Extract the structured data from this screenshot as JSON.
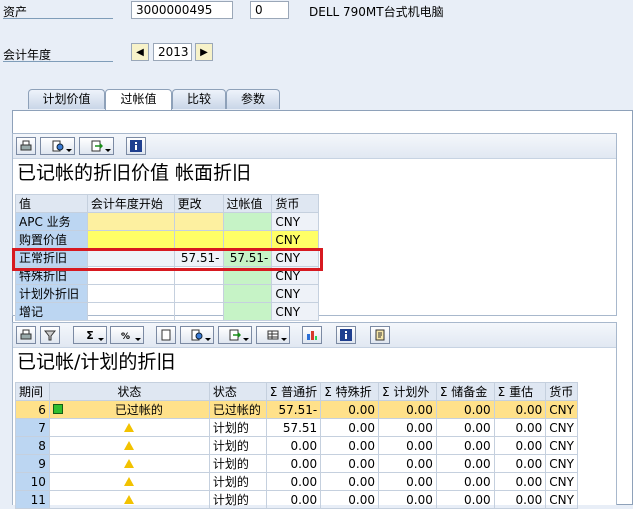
{
  "header": {
    "asset_label": "资产",
    "asset_number": "3000000495",
    "sub_number": "0",
    "asset_description": "DELL 790MT台式机电脑",
    "fiscal_year_label": "会计年度",
    "fiscal_year": "2013"
  },
  "tabs": [
    {
      "label": "计划价值"
    },
    {
      "label": "过帐值"
    },
    {
      "label": "比较"
    },
    {
      "label": "参数"
    }
  ],
  "upper": {
    "title": "已记帐的折旧价值 帐面折旧",
    "columns": [
      "值",
      "会计年度开始",
      "更改",
      "过帐值",
      "货币"
    ],
    "rows": [
      {
        "label": "APC 业务",
        "start": "",
        "change": "",
        "posted": "",
        "currency": "CNY"
      },
      {
        "label": "购置价值",
        "start": "",
        "change": "",
        "posted": "",
        "currency": "CNY"
      },
      {
        "label": "正常折旧",
        "start": "",
        "change": "57.51-",
        "posted": "57.51-",
        "currency": "CNY"
      },
      {
        "label": "特殊折旧",
        "start": "",
        "change": "",
        "posted": "",
        "currency": "CNY"
      },
      {
        "label": "计划外折旧",
        "start": "",
        "change": "",
        "posted": "",
        "currency": "CNY"
      },
      {
        "label": "增记",
        "start": "",
        "change": "",
        "posted": "",
        "currency": "CNY"
      }
    ]
  },
  "lower": {
    "title": "已记帐/计划的折旧",
    "columns": [
      "期间",
      "状态",
      "状态",
      "Σ 普通折",
      "Σ 特殊折",
      "Σ 计划外",
      "Σ 储备金",
      "Σ 重估",
      "货币"
    ],
    "rows": [
      {
        "period": "6",
        "icon": "green-square-icon",
        "status_text": "已过帐的",
        "status": "已过帐的",
        "ordinary": "57.51-",
        "special": "0.00",
        "unplanned": "0.00",
        "reserve": "0.00",
        "revaluation": "0.00",
        "currency": "CNY"
      },
      {
        "period": "7",
        "icon": "warning-triangle-icon",
        "status_text": "",
        "status": "计划的",
        "ordinary": "57.51",
        "special": "0.00",
        "unplanned": "0.00",
        "reserve": "0.00",
        "revaluation": "0.00",
        "currency": "CNY"
      },
      {
        "period": "8",
        "icon": "warning-triangle-icon",
        "status_text": "",
        "status": "计划的",
        "ordinary": "0.00",
        "special": "0.00",
        "unplanned": "0.00",
        "reserve": "0.00",
        "revaluation": "0.00",
        "currency": "CNY"
      },
      {
        "period": "9",
        "icon": "warning-triangle-icon",
        "status_text": "",
        "status": "计划的",
        "ordinary": "0.00",
        "special": "0.00",
        "unplanned": "0.00",
        "reserve": "0.00",
        "revaluation": "0.00",
        "currency": "CNY"
      },
      {
        "period": "10",
        "icon": "warning-triangle-icon",
        "status_text": "",
        "status": "计划的",
        "ordinary": "0.00",
        "special": "0.00",
        "unplanned": "0.00",
        "reserve": "0.00",
        "revaluation": "0.00",
        "currency": "CNY"
      },
      {
        "period": "11",
        "icon": "warning-triangle-icon",
        "status_text": "",
        "status": "计划的",
        "ordinary": "0.00",
        "special": "0.00",
        "unplanned": "0.00",
        "reserve": "0.00",
        "revaluation": "0.00",
        "currency": "CNY"
      }
    ]
  },
  "colors": {
    "highlight": "#d71920",
    "selected_row": "#ffe18a",
    "accent": "#1f4f9a"
  }
}
